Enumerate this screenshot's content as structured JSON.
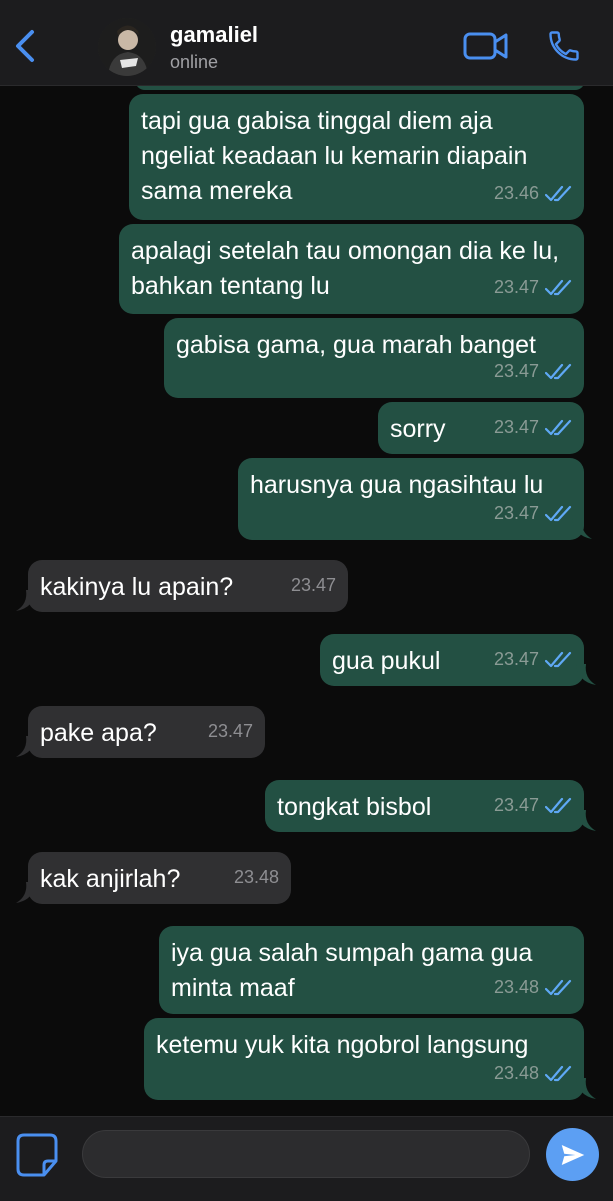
{
  "header": {
    "contact_name": "gamaliel",
    "status": "online",
    "icons": {
      "back": "chevron-left-icon",
      "video": "video-camera-icon",
      "call": "phone-icon"
    }
  },
  "colors": {
    "accent": "#4a8ff0",
    "outgoing_bubble": "#235043",
    "incoming_bubble": "#303032",
    "read_ticks": "#5fa8f5",
    "send_button": "#5c9ff3"
  },
  "messages": [
    {
      "direction": "outgoing",
      "text": "tapi gua gabisa tinggal diem aja ngeliat keadaan lu kemarin diapain sama mereka",
      "time": "23.46",
      "read": true
    },
    {
      "direction": "outgoing",
      "text": "apalagi setelah tau omongan dia ke lu, bahkan tentang lu",
      "time": "23.47",
      "read": true
    },
    {
      "direction": "outgoing",
      "text": "gabisa gama, gua marah banget",
      "time": "23.47",
      "read": true
    },
    {
      "direction": "outgoing",
      "text": "sorry",
      "time": "23.47",
      "read": true
    },
    {
      "direction": "outgoing",
      "text": "harusnya gua ngasihtau lu",
      "time": "23.47",
      "read": true
    },
    {
      "direction": "incoming",
      "text": "kakinya lu apain?",
      "time": "23.47"
    },
    {
      "direction": "outgoing",
      "text": "gua pukul",
      "time": "23.47",
      "read": true
    },
    {
      "direction": "incoming",
      "text": "pake apa?",
      "time": "23.47"
    },
    {
      "direction": "outgoing",
      "text": "tongkat bisbol",
      "time": "23.47",
      "read": true
    },
    {
      "direction": "incoming",
      "text": "kak anjirlah?",
      "time": "23.48"
    },
    {
      "direction": "outgoing",
      "text": "iya gua salah sumpah gama gua minta maaf",
      "time": "23.48",
      "read": true
    },
    {
      "direction": "outgoing",
      "text": "ketemu yuk kita ngobrol langsung",
      "time": "23.48",
      "read": true
    }
  ],
  "composer": {
    "placeholder": "",
    "value": "",
    "icons": {
      "attach": "sticker-icon",
      "send": "send-arrow-icon"
    }
  }
}
